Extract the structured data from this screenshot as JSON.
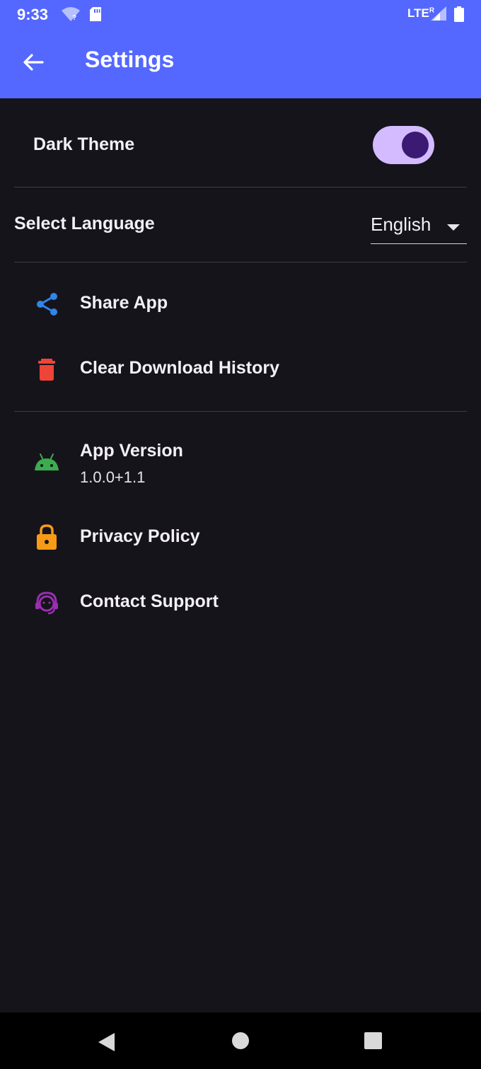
{
  "status_bar": {
    "time": "9:33",
    "network": "LTE",
    "roaming": "R"
  },
  "app_bar": {
    "title": "Settings",
    "back_icon": "arrow-back-icon",
    "color": "#5468ff"
  },
  "settings": {
    "dark_theme": {
      "label": "Dark Theme",
      "enabled": true
    },
    "language": {
      "label": "Select Language",
      "selected": "English"
    },
    "actions": [
      {
        "label": "Share App",
        "icon": "share-icon",
        "color": "#2f86e8"
      },
      {
        "label": "Clear Download History",
        "icon": "trash-icon",
        "color": "#ef4438"
      }
    ],
    "info": {
      "app_version": {
        "label": "App Version",
        "value": "1.0.0+1.1",
        "icon": "android-icon",
        "color": "#3dab4f"
      },
      "privacy_policy": {
        "label": "Privacy Policy",
        "icon": "lock-icon",
        "color": "#f79a16"
      },
      "contact_support": {
        "label": "Contact Support",
        "icon": "support-agent-icon",
        "color": "#9a2fb0"
      }
    }
  },
  "nav_bar": {
    "back": "nav-back-icon",
    "home": "nav-home-icon",
    "recents": "nav-recents-icon"
  }
}
